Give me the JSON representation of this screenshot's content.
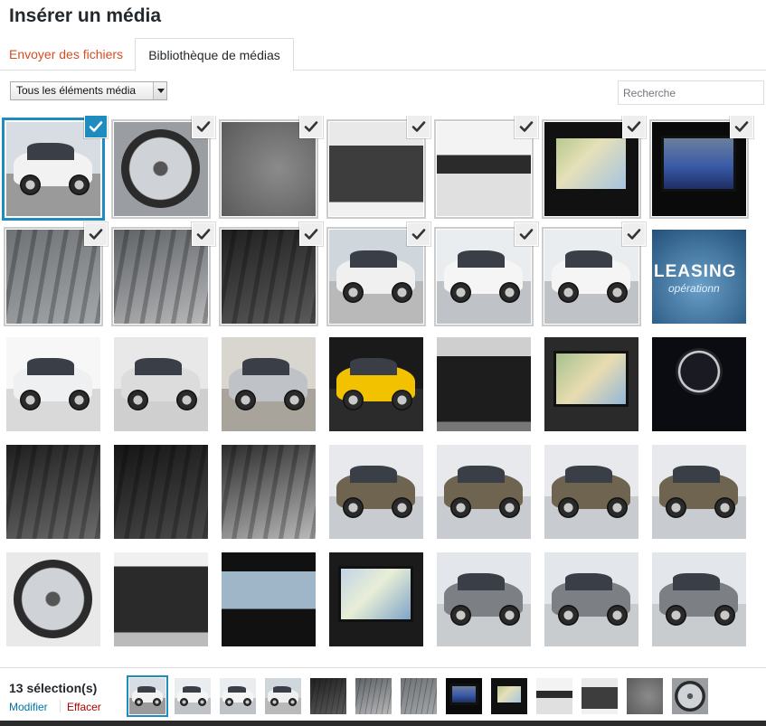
{
  "title": "Insérer un média",
  "tabs": {
    "upload": "Envoyer des fichiers",
    "library": "Bibliothèque de médias"
  },
  "filter": {
    "selected": "Tous les éléments média"
  },
  "search": {
    "placeholder": "Recherche"
  },
  "colors": {
    "accent": "#1e8cbe",
    "tab_link": "#d54e21",
    "link": "#0073aa",
    "danger": "#a00000"
  },
  "grid": {
    "items": [
      {
        "kind": "white-suv-front",
        "selected": true,
        "focused": true
      },
      {
        "kind": "alloy-wheel",
        "selected": true
      },
      {
        "kind": "trunk-carpet",
        "selected": true
      },
      {
        "kind": "trunk-open",
        "selected": true
      },
      {
        "kind": "tailgate-open",
        "selected": true
      },
      {
        "kind": "nav-screen",
        "selected": true
      },
      {
        "kind": "camera-screen",
        "selected": true
      },
      {
        "kind": "rear-seats-grey",
        "selected": true
      },
      {
        "kind": "front-seats-grey",
        "selected": true
      },
      {
        "kind": "dashboard-black",
        "selected": true
      },
      {
        "kind": "white-suv-rear",
        "selected": true
      },
      {
        "kind": "white-suv-side",
        "selected": true
      },
      {
        "kind": "white-suv-side-2",
        "selected": true
      },
      {
        "kind": "leasing-banner",
        "selected": false,
        "text": "LEASING",
        "subtext": "opérationn"
      },
      {
        "kind": "range-rover-white",
        "selected": false
      },
      {
        "kind": "white-coupe-wheel",
        "selected": false
      },
      {
        "kind": "silver-coupe",
        "selected": false
      },
      {
        "kind": "yellow-amg",
        "selected": false
      },
      {
        "kind": "trunk-black",
        "selected": false
      },
      {
        "kind": "center-console",
        "selected": false
      },
      {
        "kind": "gauges",
        "selected": false
      },
      {
        "kind": "black-interior",
        "selected": false
      },
      {
        "kind": "rear-seats-black",
        "selected": false
      },
      {
        "kind": "dashboard-citroen",
        "selected": false
      },
      {
        "kind": "bronze-car-front",
        "selected": false
      },
      {
        "kind": "bronze-car-rear",
        "selected": false
      },
      {
        "kind": "bronze-car-side",
        "selected": false
      },
      {
        "kind": "bronze-car-front-2",
        "selected": false
      },
      {
        "kind": "bmw-wheel",
        "selected": false
      },
      {
        "kind": "trunk-bmw",
        "selected": false
      },
      {
        "kind": "sunroof",
        "selected": false
      },
      {
        "kind": "nav-screen-bmw",
        "selected": false
      },
      {
        "kind": "grey-x5-front",
        "selected": false
      },
      {
        "kind": "grey-x5-rear",
        "selected": false
      },
      {
        "kind": "grey-x5-front-2",
        "selected": false
      }
    ]
  },
  "footer": {
    "count": "13 sélection(s)",
    "edit": "Modifier",
    "clear": "Effacer",
    "strip": [
      "white-suv-front",
      "white-suv-side",
      "white-suv-side-2",
      "white-suv-rear",
      "dashboard-black",
      "front-seats-grey",
      "rear-seats-grey",
      "camera-screen",
      "nav-screen",
      "tailgate-open",
      "trunk-open",
      "trunk-carpet",
      "alloy-wheel"
    ]
  }
}
